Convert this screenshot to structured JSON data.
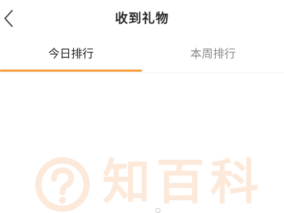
{
  "header": {
    "title": "收到礼物",
    "back_icon": "chevron-left-icon"
  },
  "tabs": [
    {
      "label": "今日排行",
      "active": true
    },
    {
      "label": "本周排行",
      "active": false
    }
  ],
  "colors": {
    "accent": "#f39a3b",
    "active_tab_text": "#222222",
    "inactive_tab_text": "#8a8a8a"
  },
  "watermark": {
    "text": "知百科",
    "icon": "question-badge-icon"
  }
}
